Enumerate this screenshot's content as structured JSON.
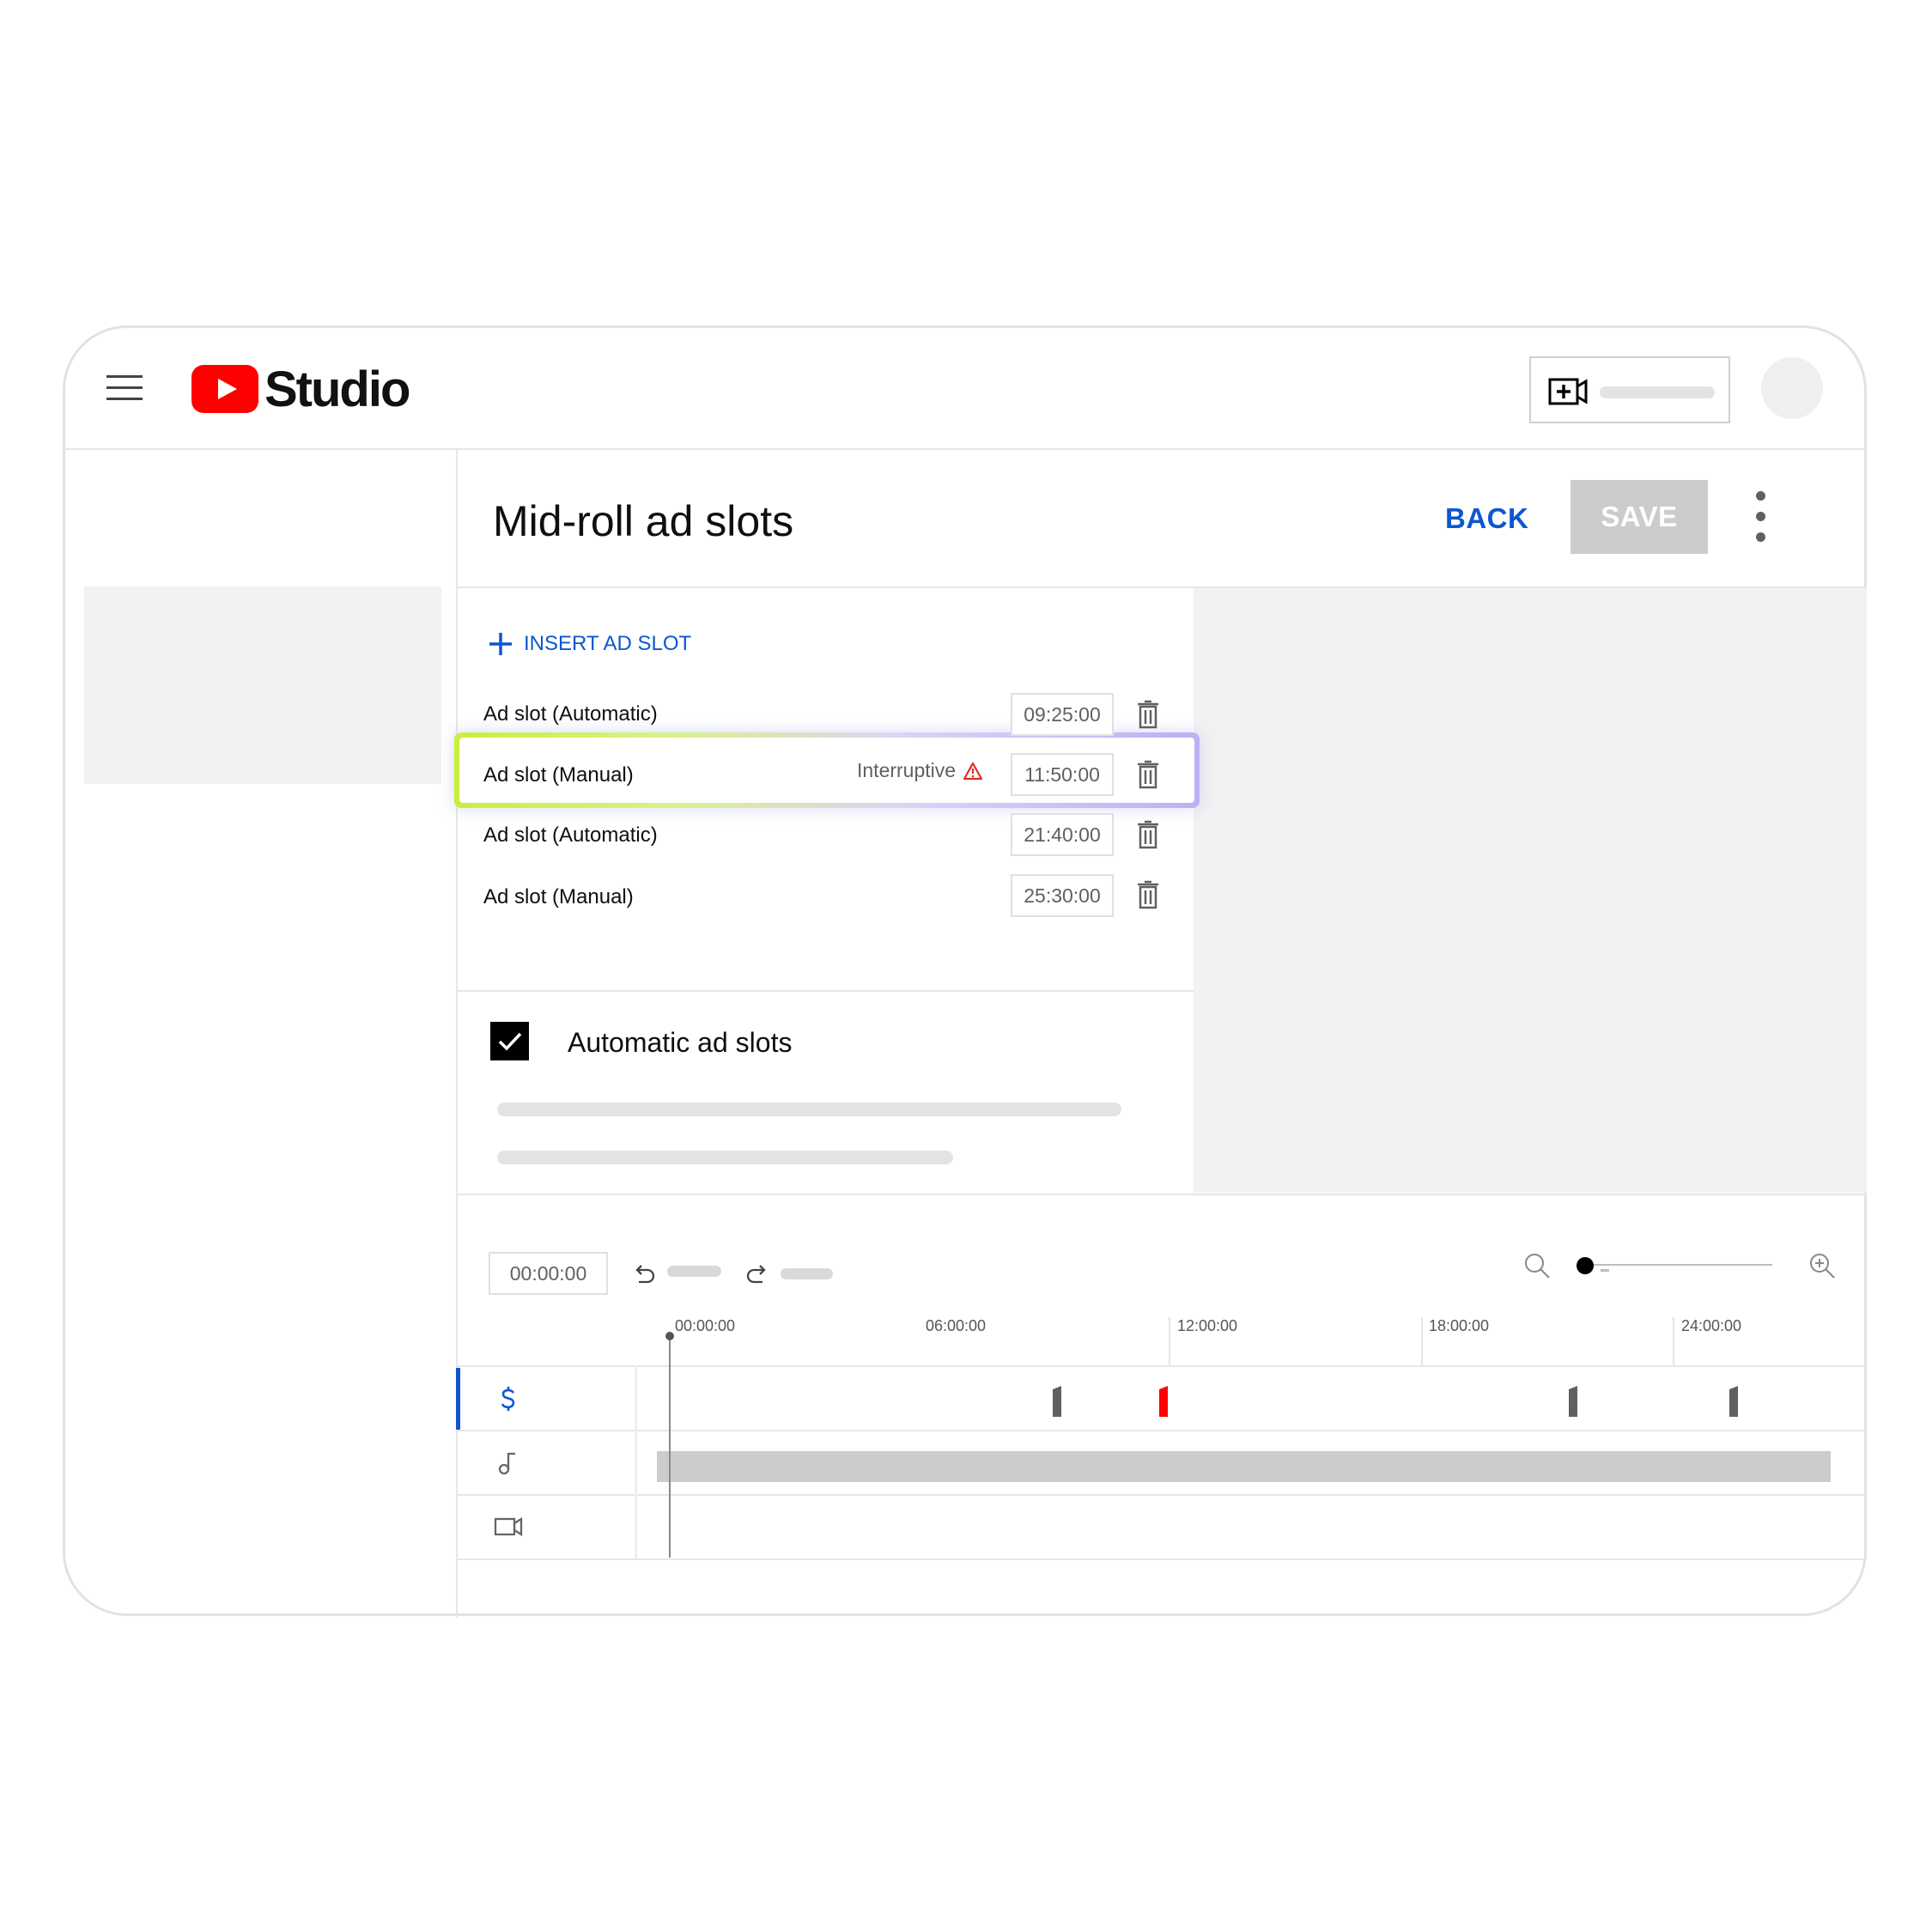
{
  "app": {
    "logo_text": "Studio",
    "brand_color": "#ff0000",
    "accent_color": "#0b57d0"
  },
  "header": {
    "menu_icon": "hamburger-icon",
    "create_icon": "video-add-icon",
    "avatar": "avatar"
  },
  "page": {
    "title": "Mid-roll ad slots",
    "back_label": "BACK",
    "save_label": "SAVE",
    "more_icon": "kebab-icon"
  },
  "ad_slots": {
    "insert_label": "INSERT AD SLOT",
    "items": [
      {
        "label": "Ad slot (Automatic)",
        "time": "09:25:00",
        "warning": ""
      },
      {
        "label": "Ad slot (Manual)",
        "time": "11:50:00",
        "warning": "Interruptive",
        "highlighted": true
      },
      {
        "label": "Ad slot (Automatic)",
        "time": "21:40:00",
        "warning": ""
      },
      {
        "label": "Ad slot (Manual)",
        "time": "25:30:00",
        "warning": ""
      }
    ]
  },
  "automatic": {
    "label": "Automatic ad slots",
    "checked": true
  },
  "timeline": {
    "timecode": "00:00:00",
    "ticks": [
      "00:00:00",
      "06:00:00",
      "12:00:00",
      "18:00:00",
      "24:00:00"
    ],
    "tracks": [
      {
        "name": "ads",
        "icon": "dollar-icon",
        "active": true
      },
      {
        "name": "audio",
        "icon": "music-note-icon"
      },
      {
        "name": "video",
        "icon": "video-camera-icon"
      }
    ],
    "marker_colors": {
      "normal": "#606060",
      "warning": "#ff0000"
    }
  }
}
